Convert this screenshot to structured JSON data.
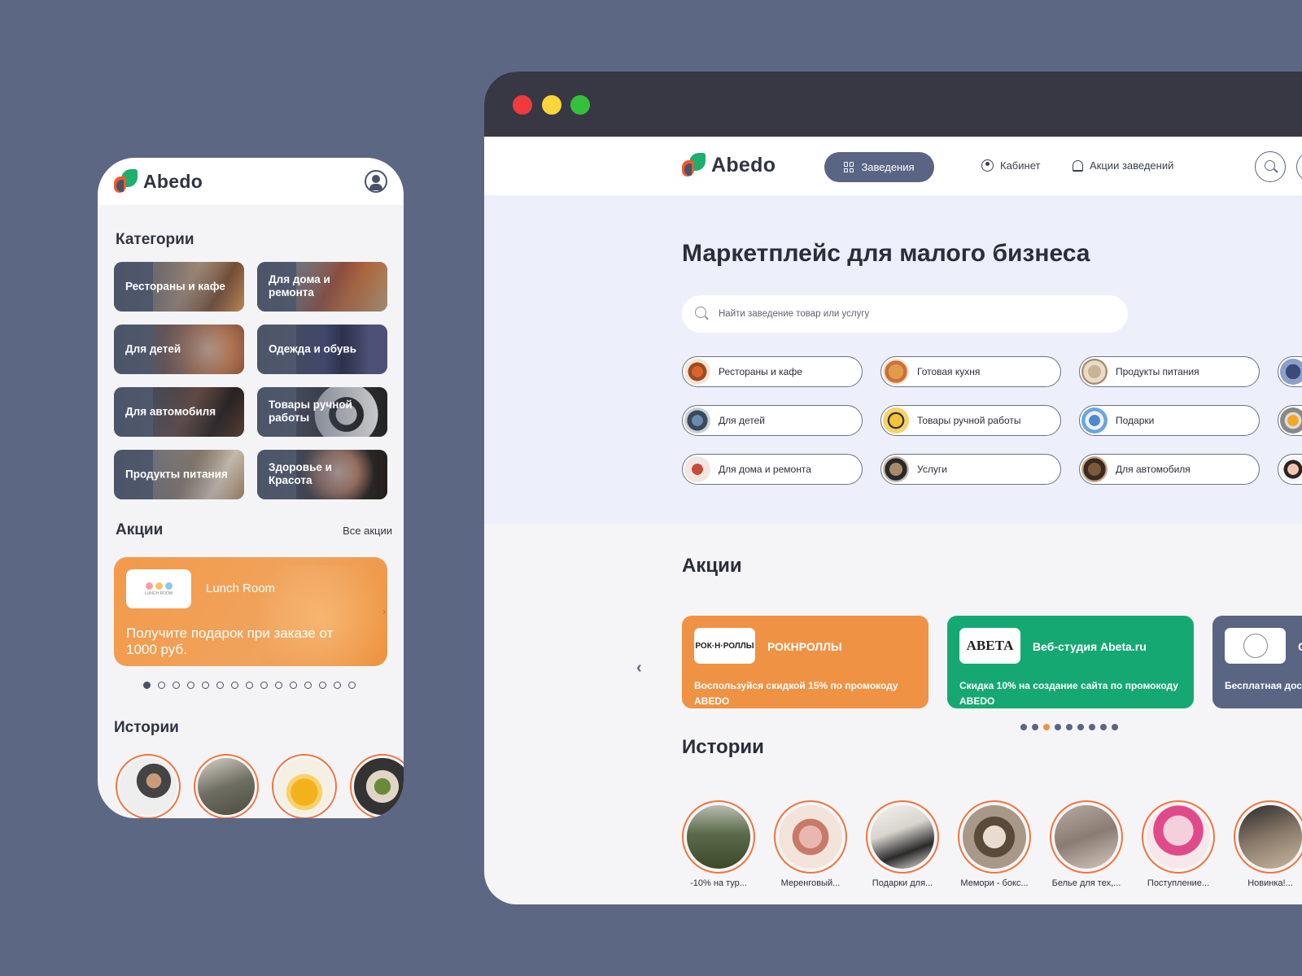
{
  "mobile": {
    "brand": "Abedo",
    "categories_title": "Категории",
    "categories": [
      {
        "label": "Рестораны и кафе"
      },
      {
        "label": "Для дома и ремонта"
      },
      {
        "label": "Для детей"
      },
      {
        "label": "Одежда и обувь"
      },
      {
        "label": "Для автомобиля"
      },
      {
        "label": "Товары ручной работы"
      },
      {
        "label": "Продукты питания"
      },
      {
        "label": "Здоровье и Красота"
      }
    ],
    "promos_title": "Акции",
    "all_promos": "Все акции",
    "promo": {
      "brand": "Lunch Room",
      "text": "Получите подарок при заказе от 1000 руб."
    },
    "carousel_pages": 15,
    "carousel_active": 0,
    "stories_title": "Истории"
  },
  "desktop": {
    "brand": "Abedo",
    "nav": {
      "places": "Заведения",
      "cabinet": "Кабинет",
      "promos": "Акции заведений"
    },
    "hero_title": "Маркетплейс для малого бизнеса",
    "search_placeholder": "Найти заведение товар или услугу",
    "categories": [
      "Рестораны и кафе",
      "Готовая кухня",
      "Продукты питания",
      "",
      "Для детей",
      "Товары ручной работы",
      "Подарки",
      "",
      "Для дома и ремонта",
      "Услуги",
      "Для автомобиля",
      ""
    ],
    "promos_title": "Акции",
    "promo_cards": [
      {
        "logo": "РОК·Н·РОЛЛЫ",
        "name": "РОКНРОЛЛЫ",
        "text": "Воспользуйся скидкой 15% по промокоду ABEDO",
        "color": "#ef9244"
      },
      {
        "logo": "AВЕТА",
        "name": "Веб-студия Abeta.ru",
        "text": "Скидка 10% на создание сайта по промокоду ABEDO",
        "color": "#16a873"
      },
      {
        "logo": "",
        "name": "C",
        "text": "Бесплатная доставка",
        "color": "#5a6584"
      }
    ],
    "carousel_pages": 9,
    "carousel_active": 2,
    "stories_title": "Истории",
    "stories": [
      "-10% на тур...",
      "Меренговый...",
      "Подарки для...",
      "Мемори - бокс...",
      "Белье для тех,...",
      "Поступление...",
      "Новинка!..."
    ]
  }
}
